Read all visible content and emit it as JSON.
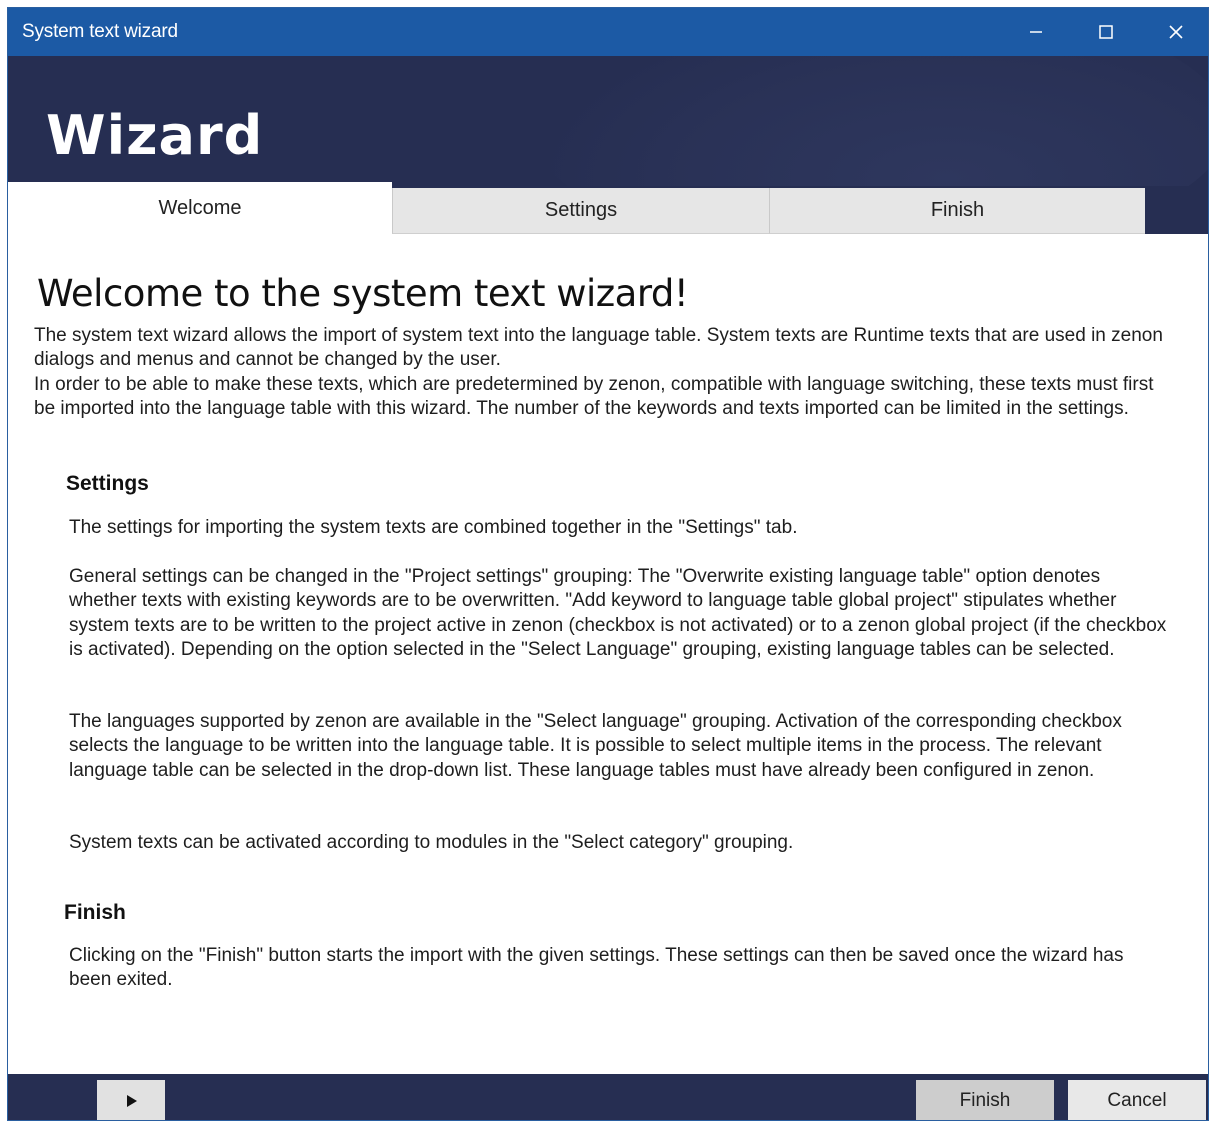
{
  "window": {
    "title": "System text wizard",
    "controls": {
      "minimize": "minimize-icon",
      "maximize": "maximize-icon",
      "close": "close-icon"
    }
  },
  "header": {
    "title": "Wizard"
  },
  "tabs": [
    {
      "label": "Welcome",
      "active": true
    },
    {
      "label": "Settings",
      "active": false
    },
    {
      "label": "Finish",
      "active": false
    }
  ],
  "content": {
    "title": "Welcome to the system text wizard!",
    "intro": [
      "The system text wizard allows the import of system text into the language table. System texts are Runtime texts  that are used in zenon dialogs and menus and cannot be changed by the user.",
      "In order to be able to make these texts, which are predetermined by zenon, compatible with language switching, these texts must first be imported into the language table with this wizard. The number of the keywords and texts imported can be limited in the settings."
    ],
    "settings": {
      "heading": "Settings",
      "paragraphs": [
        "The settings for importing the system texts are combined together in the \"Settings\" tab.",
        "General settings can be changed in the \"Project settings\" grouping: The \"Overwrite existing language table\" option denotes whether texts with existing keywords are to be overwritten. \"Add keyword to language table global project\" stipulates whether system texts are to be written to the project active in zenon (checkbox is not activated) or to a zenon global project (if the checkbox is activated). Depending on the option selected in the \"Select Language\" grouping, existing language tables can be selected.",
        "The languages supported by zenon are available in the \"Select language\" grouping. Activation of the corresponding checkbox selects the language to be written into the language table. It is possible to select multiple items in the process. The relevant language table can be selected in the drop-down list. These language tables must have already been configured in zenon.",
        "System texts can be activated according to modules in the \"Select category\" grouping."
      ]
    },
    "finish": {
      "heading": "Finish",
      "paragraph": "Clicking on the \"Finish\" button starts the import with the given settings. These settings can then be saved once the wizard has been exited."
    }
  },
  "footer": {
    "play_icon": "play-icon",
    "finish_label": "Finish",
    "cancel_label": "Cancel"
  },
  "colors": {
    "titlebar": "#1c5aa5",
    "header": "#262e52",
    "tab_inactive": "#e6e6e6",
    "button": "#e1e1e1"
  }
}
